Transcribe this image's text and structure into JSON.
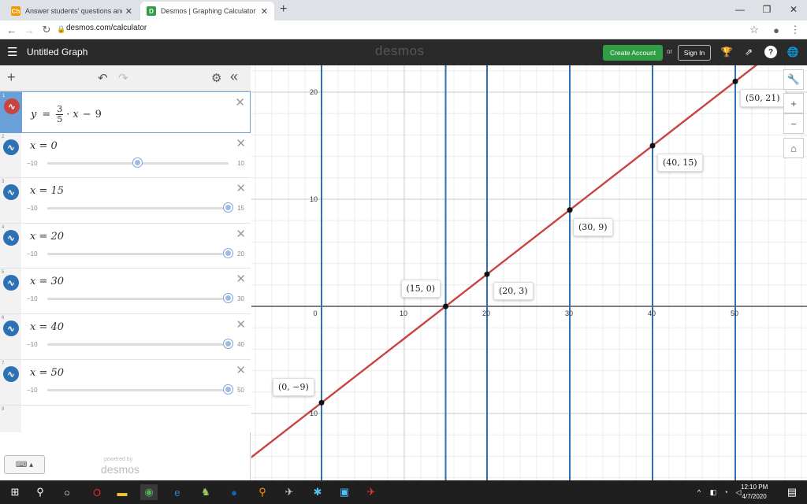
{
  "browser": {
    "tabs": [
      {
        "title": "Answer students' questions and ear",
        "favicon": "Ch",
        "active": false
      },
      {
        "title": "Desmos | Graphing Calculator",
        "favicon": "D",
        "active": true
      }
    ],
    "new_tab": "+",
    "url": "desmos.com/calculator"
  },
  "header": {
    "menu_icon": "☰",
    "title": "Untitled Graph",
    "logo": "desmos",
    "create_account": "Create Account",
    "or": "or",
    "sign_in": "Sign In"
  },
  "panel": {
    "add": "+",
    "undo": "↶",
    "redo": "↷",
    "settings": "⚙",
    "collapse": "«"
  },
  "expressions": [
    {
      "index": "1",
      "type": "function",
      "latex": "y = 3/5 · x − 9",
      "color": "#c74440"
    },
    {
      "index": "2",
      "type": "slider",
      "text": "x = 0",
      "min": "−10",
      "max": "10",
      "value": 0,
      "color": "#2d70b3"
    },
    {
      "index": "3",
      "type": "slider",
      "text": "x = 15",
      "min": "−10",
      "max": "15",
      "value": 15,
      "color": "#2d70b3"
    },
    {
      "index": "4",
      "type": "slider",
      "text": "x = 20",
      "min": "−10",
      "max": "20",
      "value": 20,
      "color": "#2d70b3"
    },
    {
      "index": "5",
      "type": "slider",
      "text": "x = 30",
      "min": "−10",
      "max": "30",
      "value": 30,
      "color": "#2d70b3"
    },
    {
      "index": "6",
      "type": "slider",
      "text": "x = 40",
      "min": "−10",
      "max": "40",
      "value": 40,
      "color": "#2d70b3"
    },
    {
      "index": "7",
      "type": "slider",
      "text": "x = 50",
      "min": "−10",
      "max": "50",
      "value": 50,
      "color": "#2d70b3"
    },
    {
      "index": "8",
      "type": "empty"
    }
  ],
  "footer": {
    "keyboard": "⌨ ▴",
    "powered_by": "powered by",
    "logo": "desmos"
  },
  "graph": {
    "x_ticks": [
      "0",
      "10",
      "20",
      "30",
      "40",
      "50"
    ],
    "y_ticks": [
      "20",
      "10",
      "10"
    ],
    "lines_x": [
      0,
      15,
      20,
      30,
      40,
      50
    ],
    "points": [
      {
        "x": 0,
        "y": -9,
        "label": "(0, −9)"
      },
      {
        "x": 15,
        "y": 0,
        "label": "(15, 0)"
      },
      {
        "x": 20,
        "y": 3,
        "label": "(20, 3)"
      },
      {
        "x": 30,
        "y": 9,
        "label": "(30, 9)"
      },
      {
        "x": 40,
        "y": 15,
        "label": "(40, 15)"
      },
      {
        "x": 50,
        "y": 21,
        "label": "(50, 21)"
      }
    ],
    "line_color": "#c74440",
    "vline_color": "#2d70b3",
    "tools": {
      "wrench": "🔧",
      "zoom_in": "+",
      "zoom_out": "−",
      "home": "⌂"
    }
  },
  "taskbar": {
    "time": "12:10 PM",
    "date": "4/7/2020"
  }
}
